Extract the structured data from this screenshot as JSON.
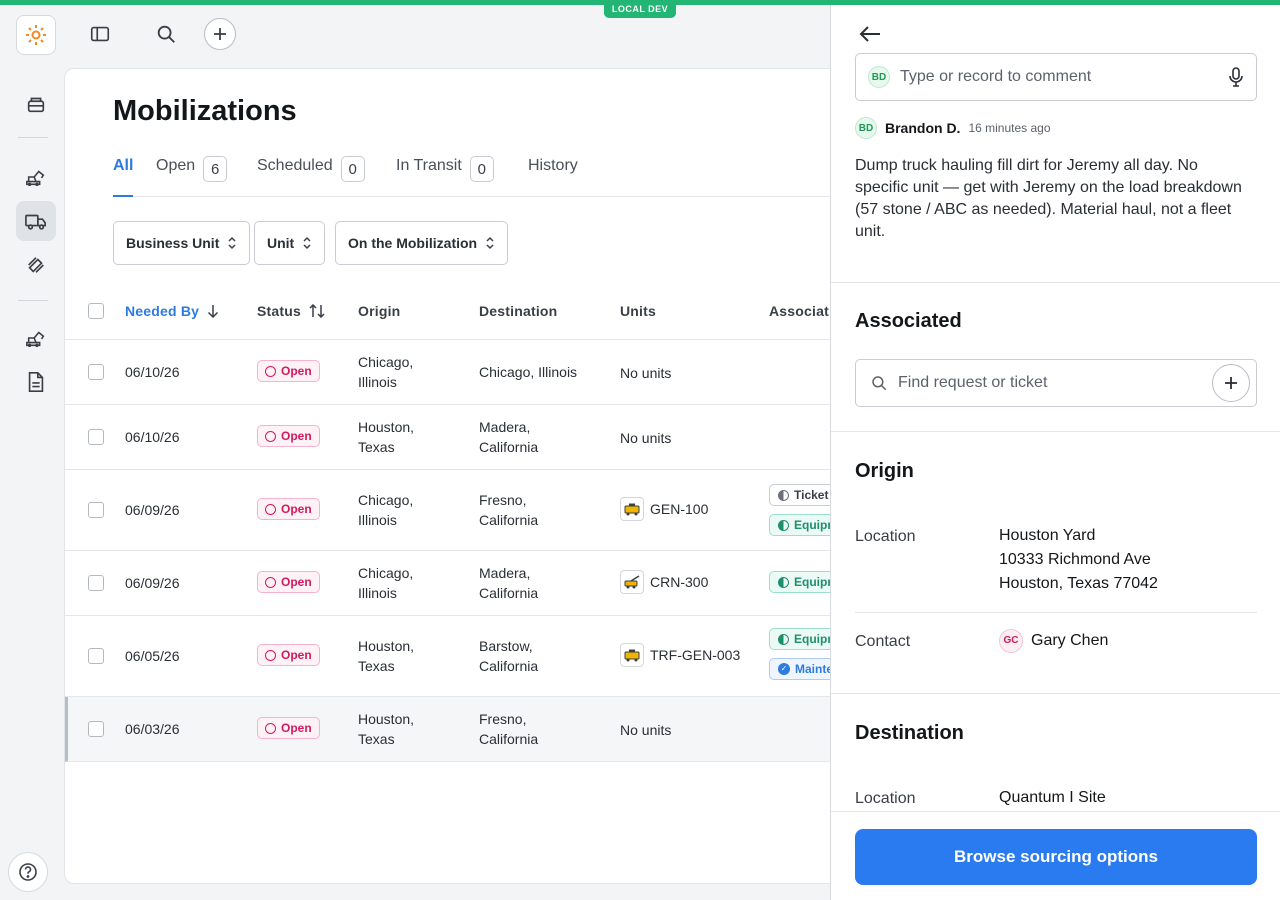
{
  "env": {
    "badge": "LOCAL DEV"
  },
  "page": {
    "title": "Mobilizations",
    "tabs": [
      {
        "label": "All",
        "count": null,
        "active": true
      },
      {
        "label": "Open",
        "count": "6"
      },
      {
        "label": "Scheduled",
        "count": "0"
      },
      {
        "label": "In Transit",
        "count": "0"
      },
      {
        "label": "History",
        "count": null
      }
    ],
    "filters": [
      "Business Unit",
      "Unit",
      "On the Mobilization"
    ],
    "columns": [
      "Needed By",
      "Status",
      "Origin",
      "Destination",
      "Units",
      "Associat"
    ],
    "rows": [
      {
        "needed_by": "06/10/26",
        "status": "Open",
        "origin": [
          "Chicago,",
          "Illinois"
        ],
        "destination": [
          "Chicago, Illinois"
        ],
        "units": "No units",
        "assoc": []
      },
      {
        "needed_by": "06/10/26",
        "status": "Open",
        "origin": [
          "Houston,",
          "Texas"
        ],
        "destination": [
          "Madera,",
          "California"
        ],
        "units": "No units",
        "assoc": []
      },
      {
        "needed_by": "06/09/26",
        "status": "Open",
        "origin": [
          "Chicago,",
          "Illinois"
        ],
        "destination": [
          "Fresno,",
          "California"
        ],
        "units": "GEN-100",
        "assoc": [
          "Ticket",
          "Equipm"
        ]
      },
      {
        "needed_by": "06/09/26",
        "status": "Open",
        "origin": [
          "Chicago,",
          "Illinois"
        ],
        "destination": [
          "Madera,",
          "California"
        ],
        "units": "CRN-300",
        "assoc": [
          "Equipm"
        ]
      },
      {
        "needed_by": "06/05/26",
        "status": "Open",
        "origin": [
          "Houston,",
          "Texas"
        ],
        "destination": [
          "Barstow,",
          "California"
        ],
        "units": "TRF-GEN-003",
        "assoc": [
          "Equipm",
          "Mainte"
        ]
      },
      {
        "needed_by": "06/03/26",
        "status": "Open",
        "origin": [
          "Houston,",
          "Texas"
        ],
        "destination": [
          "Fresno,",
          "California"
        ],
        "units": "No units",
        "assoc": []
      }
    ]
  },
  "drawer": {
    "comment_placeholder": "Type or record to comment",
    "comment": {
      "initials": "BD",
      "author": "Brandon D.",
      "time": "16 minutes ago",
      "text": "Dump truck hauling fill dirt for Jeremy all day. No specific unit — get with Jeremy on the load breakdown (57 stone / ABC as needed). Material haul, not a fleet unit."
    },
    "associated": {
      "title": "Associated",
      "placeholder": "Find request or ticket"
    },
    "origin": {
      "title": "Origin",
      "location_label": "Location",
      "location": [
        "Houston Yard",
        "10333 Richmond Ave",
        "Houston, Texas 77042"
      ],
      "contact_label": "Contact",
      "contact_initials": "GC",
      "contact_name": "Gary Chen"
    },
    "destination": {
      "title": "Destination",
      "location_label": "Location",
      "location": "Quantum I Site"
    },
    "primary_button": "Browse sourcing options"
  },
  "colors": {
    "accent": "#2b7bf0",
    "env": "#22b573",
    "status_open": "#d11a5d"
  }
}
